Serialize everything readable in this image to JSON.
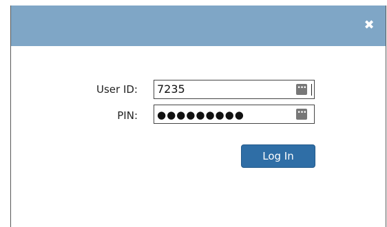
{
  "dialog": {
    "close_glyph": "✖"
  },
  "form": {
    "user_id_label": "User ID:",
    "user_id_value": "7235",
    "pin_label": "PIN:",
    "pin_value": "●●●●●●●●●",
    "password_icon_glyph": "•••"
  },
  "actions": {
    "login_label": "Log In"
  },
  "colors": {
    "titlebar": "#7fa6c6",
    "button": "#2f6ea6"
  }
}
